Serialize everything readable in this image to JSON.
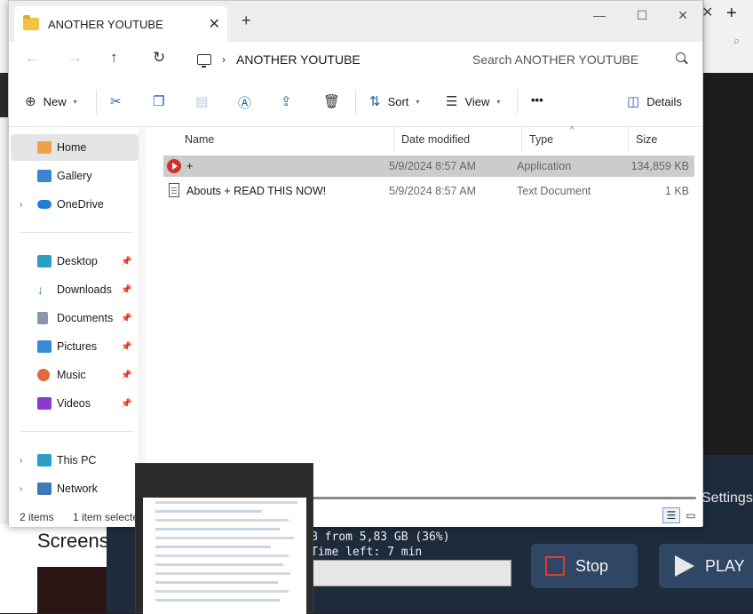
{
  "explorer": {
    "tab_title": "ANOTHER YOUTUBE",
    "path_segment": "ANOTHER YOUTUBE",
    "search_placeholder": "Search ANOTHER YOUTUBE",
    "toolbar": {
      "new_label": "New",
      "sort_label": "Sort",
      "view_label": "View",
      "more_label": "•••",
      "details_label": "Details"
    },
    "nav": {
      "items": [
        {
          "label": "Home",
          "icon": "home-icon",
          "selected": true
        },
        {
          "label": "Gallery",
          "icon": "gallery-icon"
        },
        {
          "label": "OneDrive",
          "icon": "onedrive-icon",
          "expandable": true
        },
        {
          "label": "Desktop",
          "icon": "desktop-icon",
          "pinned": true
        },
        {
          "label": "Downloads",
          "icon": "downloads-icon",
          "pinned": true
        },
        {
          "label": "Documents",
          "icon": "documents-icon",
          "pinned": true
        },
        {
          "label": "Pictures",
          "icon": "pictures-icon",
          "pinned": true
        },
        {
          "label": "Music",
          "icon": "music-icon",
          "pinned": true
        },
        {
          "label": "Videos",
          "icon": "videos-icon",
          "pinned": true
        },
        {
          "label": "This PC",
          "icon": "this-pc-icon",
          "expandable": true
        },
        {
          "label": "Network",
          "icon": "network-icon",
          "expandable": true
        }
      ]
    },
    "columns": {
      "name": "Name",
      "date": "Date modified",
      "type": "Type",
      "size": "Size"
    },
    "files": [
      {
        "name": "+",
        "date": "5/9/2024 8:57 AM",
        "type": "Application",
        "size": "134,859 KB",
        "selected": true
      },
      {
        "name": "Abouts + READ THIS NOW!",
        "date": "5/9/2024 8:57 AM",
        "type": "Text Document",
        "size": "1 KB"
      }
    ],
    "status": {
      "count": "2 items",
      "selection": "1 item selecte"
    }
  },
  "installer": {
    "settings_label": "Settings",
    "progress_line1": "B from 5,83 GB (36%)",
    "progress_line2": "Time left: 7 min",
    "stop_label": "Stop",
    "play_label": "PLAY"
  },
  "background_page": {
    "heading": "Screens"
  },
  "colors": {
    "accent": "#1f5fa8",
    "installer_bg": "#1e2b3c",
    "button_bg": "#2f4764",
    "stop_red": "#e53935",
    "selected_row": "#cccccc"
  }
}
